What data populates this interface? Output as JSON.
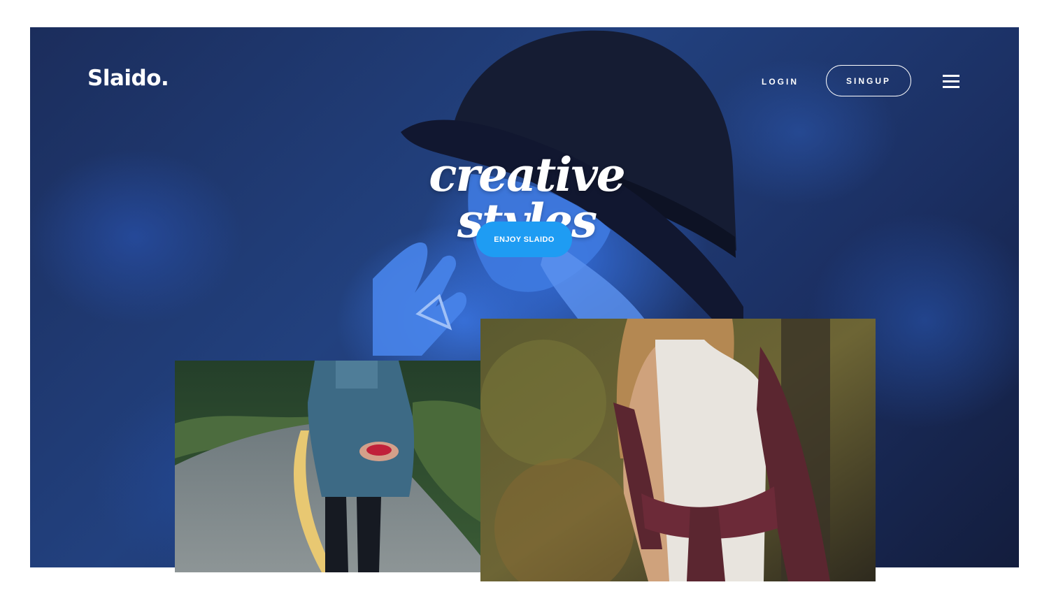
{
  "header": {
    "logo": "Slaido.",
    "login_label": "LOGIN",
    "signup_label": "SINGUP"
  },
  "hero": {
    "headline": "creative styles",
    "cta_label": "ENJOY SLAIDO"
  },
  "colors": {
    "hero_tint": "#2a5bc4",
    "cta_background": "#1e9cf3",
    "text": "#ffffff"
  },
  "icons": {
    "menu": "hamburger-menu-icon"
  }
}
